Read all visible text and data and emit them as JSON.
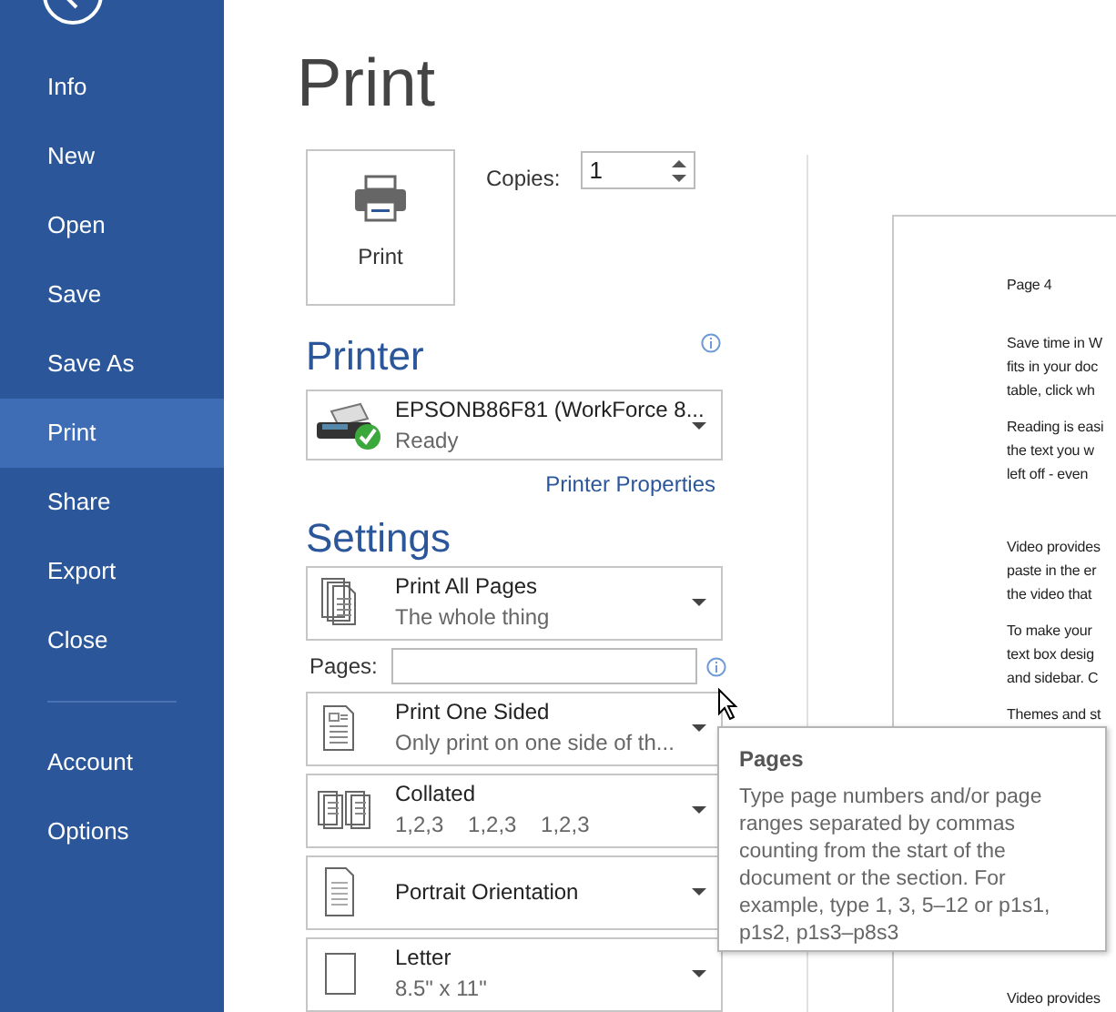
{
  "sidebar": {
    "items": [
      {
        "label": "Info",
        "selected": false
      },
      {
        "label": "New",
        "selected": false
      },
      {
        "label": "Open",
        "selected": false
      },
      {
        "label": "Save",
        "selected": false
      },
      {
        "label": "Save As",
        "selected": false
      },
      {
        "label": "Print",
        "selected": true
      },
      {
        "label": "Share",
        "selected": false
      },
      {
        "label": "Export",
        "selected": false
      },
      {
        "label": "Close",
        "selected": false
      }
    ],
    "bottom_items": [
      {
        "label": "Account",
        "selected": false
      },
      {
        "label": "Options",
        "selected": false
      }
    ]
  },
  "title": "Print",
  "print_button": {
    "label": "Print"
  },
  "copies": {
    "label": "Copies:",
    "value": "1"
  },
  "printer": {
    "heading": "Printer",
    "name": "EPSONB86F81 (WorkForce 8...",
    "status": "Ready",
    "properties_link": "Printer Properties"
  },
  "settings": {
    "heading": "Settings",
    "items": [
      {
        "kind": "dropdown",
        "title": "Print All Pages",
        "subtitle": "The whole thing"
      },
      {
        "kind": "field",
        "label": "Pages:"
      },
      {
        "kind": "dropdown",
        "title": "Print One Sided",
        "subtitle": "Only print on one side of th..."
      },
      {
        "kind": "dropdown",
        "title": "Collated",
        "subtitle": "1,2,3    1,2,3    1,2,3"
      },
      {
        "kind": "dropdown",
        "title": "Portrait Orientation"
      },
      {
        "kind": "dropdown",
        "title": "Letter",
        "subtitle": "8.5\" x 11\""
      }
    ]
  },
  "tooltip": {
    "title": "Pages",
    "text": "Type page numbers and/or page ranges separated by commas counting from the start of the document or the section. For example, type 1, 3, 5–12 or p1s1, p1s2, p1s3–p8s3"
  },
  "preview": {
    "header": "Page 4",
    "paragraphs": [
      {
        "lines": [
          "Save time in W",
          "fits in your doc",
          "table, click wh"
        ]
      },
      {
        "lines": [
          "Reading is easi",
          "the text you w",
          "left off - even"
        ]
      },
      {
        "lines": [
          "Video provides",
          "paste in the er",
          "the video that"
        ]
      },
      {
        "lines": [
          "To make your",
          "text box desig",
          "and sidebar. C"
        ]
      },
      {
        "lines": [
          "Themes and st"
        ]
      },
      {
        "lines": [
          "Video provides"
        ]
      }
    ]
  }
}
